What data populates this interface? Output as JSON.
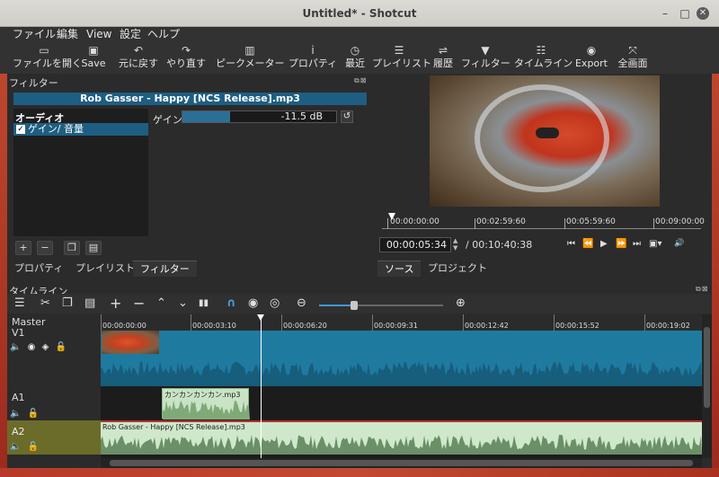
{
  "window": {
    "title": "Untitled* - Shotcut",
    "minimize_glyph": "–",
    "maximize_glyph": "□",
    "close_glyph": "✕"
  },
  "menu": [
    "ファイル",
    "編集",
    "View",
    "設定",
    "ヘルプ"
  ],
  "toolbar": [
    {
      "icon": "folder-open-icon",
      "glyph": "▭",
      "label": "ファイルを開く"
    },
    {
      "icon": "save-icon",
      "glyph": "▣",
      "label": "Save"
    },
    {
      "icon": "undo-icon",
      "glyph": "↶",
      "label": "元に戻す"
    },
    {
      "icon": "redo-icon",
      "glyph": "↷",
      "label": "やり直す"
    },
    {
      "icon": "peak-meter-icon",
      "glyph": "▥",
      "label": "ピークメーター"
    },
    {
      "icon": "info-icon",
      "glyph": "i",
      "label": "プロパティ"
    },
    {
      "icon": "clock-icon",
      "glyph": "◷",
      "label": "最近"
    },
    {
      "icon": "playlist-icon",
      "glyph": "☰",
      "label": "プレイリスト"
    },
    {
      "icon": "history-icon",
      "glyph": "⇌",
      "label": "履歴"
    },
    {
      "icon": "filter-icon",
      "glyph": "▼",
      "label": "フィルター"
    },
    {
      "icon": "timeline-icon",
      "glyph": "☷",
      "label": "タイムライン"
    },
    {
      "icon": "export-icon",
      "glyph": "◉",
      "label": "Export"
    },
    {
      "icon": "fullscreen-icon",
      "glyph": "⤧",
      "label": "全画面"
    }
  ],
  "filters": {
    "panel_title": "フィルター",
    "clip_name": "Rob Gasser - Happy [NCS Release].mp3",
    "category": "オーディオ",
    "selected_filter": "ゲイン/ 音量",
    "gain_label": "ゲイン",
    "gain_value": "-11.5 dB",
    "gain_fraction": 0.31,
    "buttons": [
      {
        "icon": "add-icon",
        "glyph": "+"
      },
      {
        "icon": "remove-icon",
        "glyph": "−"
      },
      {
        "icon": "copy-icon",
        "glyph": "❐"
      },
      {
        "icon": "paste-icon",
        "glyph": "▤"
      }
    ],
    "tabs": [
      "プロパティ",
      "プレイリスト",
      "フィルター"
    ],
    "active_tab": "フィルター"
  },
  "player": {
    "ruler_labels": [
      "00:00:00:00",
      "00:02:59:60",
      "00:05:59:60",
      "00:09:00:00"
    ],
    "current_time": "00:00:05:34",
    "total_time": "/ 00:10:40:38",
    "tabs": [
      "ソース",
      "プロジェクト"
    ],
    "controls": [
      {
        "icon": "skip-start-icon",
        "glyph": "⏮"
      },
      {
        "icon": "rewind-icon",
        "glyph": "⏪"
      },
      {
        "icon": "play-icon",
        "glyph": "▶"
      },
      {
        "icon": "fast-forward-icon",
        "glyph": "⏩"
      },
      {
        "icon": "skip-end-icon",
        "glyph": "⏭"
      },
      {
        "icon": "grid-icon",
        "glyph": "▣▾"
      },
      {
        "icon": "volume-icon",
        "glyph": "🔊"
      }
    ]
  },
  "timeline": {
    "panel_title": "タイムライン",
    "tools": [
      {
        "icon": "menu-icon",
        "glyph": "☰"
      },
      {
        "icon": "cut-icon",
        "glyph": "✂"
      },
      {
        "icon": "copy-icon",
        "glyph": "❐"
      },
      {
        "icon": "paste-icon",
        "glyph": "▤"
      },
      {
        "icon": "append-icon",
        "glyph": "+"
      },
      {
        "icon": "remove-icon",
        "glyph": "−"
      },
      {
        "icon": "lift-icon",
        "glyph": "⌃"
      },
      {
        "icon": "overwrite-icon",
        "glyph": "⌄"
      },
      {
        "icon": "split-icon",
        "glyph": "▮▮"
      },
      {
        "icon": "snap-icon",
        "glyph": "∩"
      },
      {
        "icon": "scrub-icon",
        "glyph": "◉"
      },
      {
        "icon": "ripple-icon",
        "glyph": "◎"
      },
      {
        "icon": "zoom-out-icon",
        "glyph": "⊖"
      },
      {
        "icon": "zoom-in-icon",
        "glyph": "⊕"
      }
    ],
    "zoom_level": 0.28,
    "ruler_labels": [
      "00:00:00:00",
      "00:00:03:10",
      "00:00:06:20",
      "00:00:09:31",
      "00:00:12:42",
      "00:00:15:52",
      "00:00:19:02"
    ],
    "tracks": [
      {
        "name": "Master"
      },
      {
        "name": "V1"
      },
      {
        "name": "A1",
        "clip": "カンカンカンカン.mp3"
      },
      {
        "name": "A2",
        "clip": "Rob Gasser - Happy [NCS Release].mp3"
      }
    ]
  }
}
